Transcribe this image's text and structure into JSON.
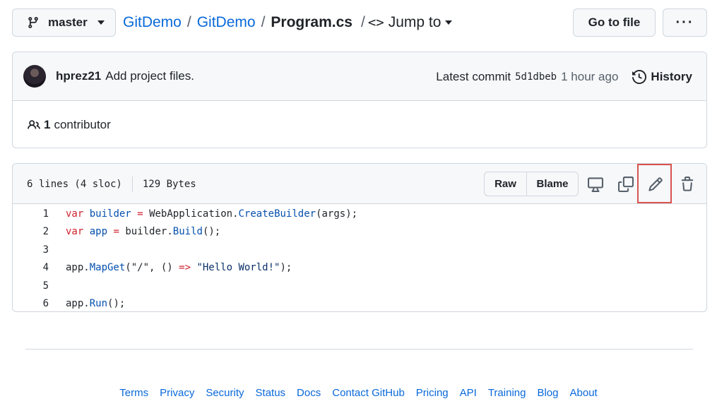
{
  "topbar": {
    "branch": "master",
    "breadcrumb": {
      "owner": "GitDemo",
      "repo": "GitDemo",
      "sep1": "/",
      "sep2": "/",
      "file": "Program.cs",
      "sep3": "/",
      "code_icon": "<>",
      "jump_label": "Jump to"
    },
    "goto_label": "Go to file",
    "more_label": "···"
  },
  "commit": {
    "author": "hprez21",
    "message": "Add project files.",
    "latest_label": "Latest commit",
    "sha": "5d1dbeb",
    "time_ago": "1 hour ago",
    "history_label": "History",
    "contributor_count": "1",
    "contributor_label": "contributor"
  },
  "file": {
    "lines_info": "6 lines (4 sloc)",
    "size": "129 Bytes",
    "raw_label": "Raw",
    "blame_label": "Blame",
    "lines": [
      {
        "num": "1"
      },
      {
        "num": "2"
      },
      {
        "num": "3"
      },
      {
        "num": "4"
      },
      {
        "num": "5"
      },
      {
        "num": "6"
      }
    ],
    "code": {
      "l1": {
        "kw": "var",
        "var": "builder",
        "eq": "=",
        "obj": "WebApplication.",
        "fn": "CreateBuilder",
        "rest": "(args);"
      },
      "l2": {
        "kw": "var",
        "var": "app",
        "eq": "=",
        "obj": "builder.",
        "fn": "Build",
        "rest": "();"
      },
      "l4": {
        "obj": "app.",
        "fn": "MapGet",
        "args1": "(\"/\", () ",
        "arrow": "=>",
        "str": "\"Hello World!\"",
        "rest": ");"
      },
      "l6": {
        "obj": "app.",
        "fn": "Run",
        "rest": "();"
      }
    }
  },
  "footer": {
    "links": [
      "Terms",
      "Privacy",
      "Security",
      "Status",
      "Docs",
      "Contact GitHub",
      "Pricing",
      "API",
      "Training",
      "Blog",
      "About"
    ]
  },
  "colors": {
    "link": "#0969da",
    "keyword": "#cf222e",
    "entity": "#0550ae",
    "highlight_box": "#d9534f"
  }
}
